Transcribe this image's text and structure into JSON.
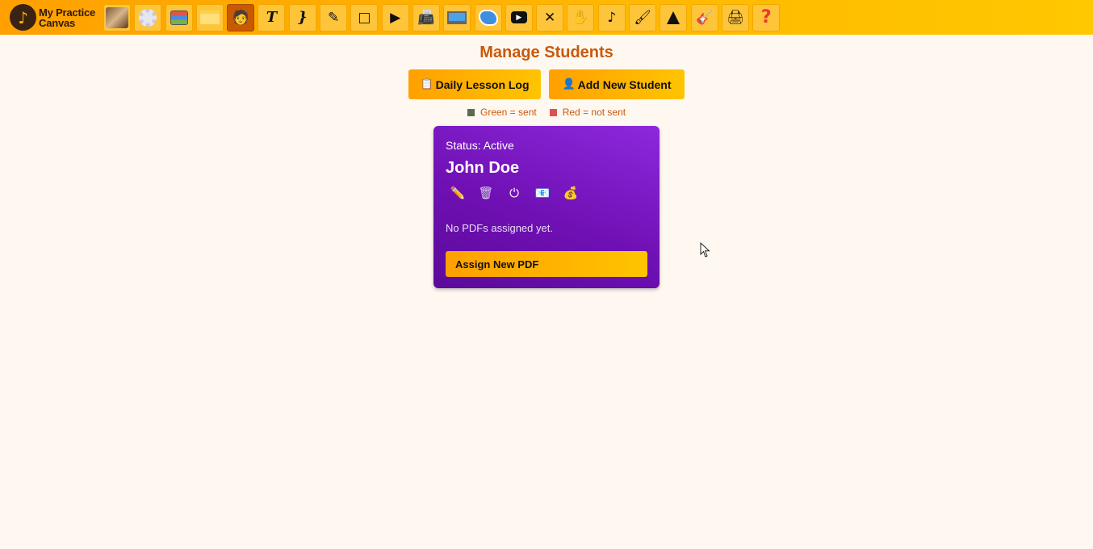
{
  "app": {
    "logo_line1": "My Practice",
    "logo_line2": "Canvas",
    "logo_glyph": "♪"
  },
  "toolbar": {
    "tools": [
      {
        "name": "photo-tool",
        "glyph": ""
      },
      {
        "name": "settings-tool",
        "glyph": ""
      },
      {
        "name": "layers-tool",
        "glyph": ""
      },
      {
        "name": "folder-tool",
        "glyph": ""
      },
      {
        "name": "students-tool",
        "glyph": "🧑"
      },
      {
        "name": "text-tool",
        "glyph": "T"
      },
      {
        "name": "brace-tool",
        "glyph": "}"
      },
      {
        "name": "marker-tool",
        "glyph": "✎"
      },
      {
        "name": "shape-tool",
        "glyph": "□"
      },
      {
        "name": "play-tool",
        "glyph": "▶"
      },
      {
        "name": "record-tool",
        "glyph": "📠"
      },
      {
        "name": "screen-tool",
        "glyph": ""
      },
      {
        "name": "blob-tool",
        "glyph": ""
      },
      {
        "name": "youtube-tool",
        "glyph": "▶"
      },
      {
        "name": "cross-tool",
        "glyph": "✕"
      },
      {
        "name": "hand-tool",
        "glyph": "✋"
      },
      {
        "name": "note-tool",
        "glyph": "♪"
      },
      {
        "name": "brush-tool",
        "glyph": "🖌"
      },
      {
        "name": "metronome-tool",
        "glyph": ""
      },
      {
        "name": "guitar-tool",
        "glyph": "🎸"
      },
      {
        "name": "print-tool",
        "glyph": "🖨"
      },
      {
        "name": "help-tool",
        "glyph": "?"
      }
    ]
  },
  "page": {
    "title": "Manage Students",
    "daily_log_label": "Daily Lesson Log",
    "daily_log_icon": "📋",
    "add_student_label": "Add New Student",
    "add_student_icon": "👤",
    "legend_green": "Green = sent",
    "legend_red": "Red = not sent"
  },
  "colors": {
    "legend_green": "#5b6b4f",
    "legend_red": "#e05050",
    "accent": "#ffa000",
    "card": "#7a16c4"
  },
  "student_card": {
    "status": "Status: Active",
    "name": "John Doe",
    "actions": [
      {
        "name": "edit-icon",
        "glyph": "✏️"
      },
      {
        "name": "trash-icon",
        "glyph": "🗑"
      },
      {
        "name": "power-icon",
        "glyph": "⏻"
      },
      {
        "name": "email-icon",
        "glyph": "📧"
      },
      {
        "name": "money-bag-icon",
        "glyph": "💰"
      }
    ],
    "no_pdfs": "No PDFs assigned yet.",
    "assign_label": "Assign New PDF"
  }
}
